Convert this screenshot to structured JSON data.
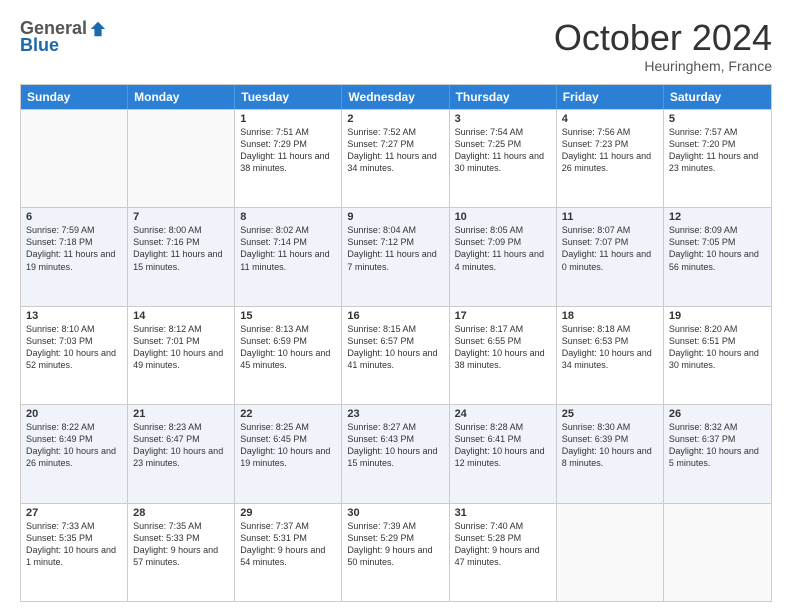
{
  "logo": {
    "general": "General",
    "blue": "Blue"
  },
  "header": {
    "month": "October 2024",
    "location": "Heuringhem, France"
  },
  "days_of_week": [
    "Sunday",
    "Monday",
    "Tuesday",
    "Wednesday",
    "Thursday",
    "Friday",
    "Saturday"
  ],
  "weeks": [
    [
      {
        "day": "",
        "sunrise": "",
        "sunset": "",
        "daylight": "",
        "empty": true
      },
      {
        "day": "",
        "sunrise": "",
        "sunset": "",
        "daylight": "",
        "empty": true
      },
      {
        "day": "1",
        "sunrise": "Sunrise: 7:51 AM",
        "sunset": "Sunset: 7:29 PM",
        "daylight": "Daylight: 11 hours and 38 minutes."
      },
      {
        "day": "2",
        "sunrise": "Sunrise: 7:52 AM",
        "sunset": "Sunset: 7:27 PM",
        "daylight": "Daylight: 11 hours and 34 minutes."
      },
      {
        "day": "3",
        "sunrise": "Sunrise: 7:54 AM",
        "sunset": "Sunset: 7:25 PM",
        "daylight": "Daylight: 11 hours and 30 minutes."
      },
      {
        "day": "4",
        "sunrise": "Sunrise: 7:56 AM",
        "sunset": "Sunset: 7:23 PM",
        "daylight": "Daylight: 11 hours and 26 minutes."
      },
      {
        "day": "5",
        "sunrise": "Sunrise: 7:57 AM",
        "sunset": "Sunset: 7:20 PM",
        "daylight": "Daylight: 11 hours and 23 minutes."
      }
    ],
    [
      {
        "day": "6",
        "sunrise": "Sunrise: 7:59 AM",
        "sunset": "Sunset: 7:18 PM",
        "daylight": "Daylight: 11 hours and 19 minutes."
      },
      {
        "day": "7",
        "sunrise": "Sunrise: 8:00 AM",
        "sunset": "Sunset: 7:16 PM",
        "daylight": "Daylight: 11 hours and 15 minutes."
      },
      {
        "day": "8",
        "sunrise": "Sunrise: 8:02 AM",
        "sunset": "Sunset: 7:14 PM",
        "daylight": "Daylight: 11 hours and 11 minutes."
      },
      {
        "day": "9",
        "sunrise": "Sunrise: 8:04 AM",
        "sunset": "Sunset: 7:12 PM",
        "daylight": "Daylight: 11 hours and 7 minutes."
      },
      {
        "day": "10",
        "sunrise": "Sunrise: 8:05 AM",
        "sunset": "Sunset: 7:09 PM",
        "daylight": "Daylight: 11 hours and 4 minutes."
      },
      {
        "day": "11",
        "sunrise": "Sunrise: 8:07 AM",
        "sunset": "Sunset: 7:07 PM",
        "daylight": "Daylight: 11 hours and 0 minutes."
      },
      {
        "day": "12",
        "sunrise": "Sunrise: 8:09 AM",
        "sunset": "Sunset: 7:05 PM",
        "daylight": "Daylight: 10 hours and 56 minutes."
      }
    ],
    [
      {
        "day": "13",
        "sunrise": "Sunrise: 8:10 AM",
        "sunset": "Sunset: 7:03 PM",
        "daylight": "Daylight: 10 hours and 52 minutes."
      },
      {
        "day": "14",
        "sunrise": "Sunrise: 8:12 AM",
        "sunset": "Sunset: 7:01 PM",
        "daylight": "Daylight: 10 hours and 49 minutes."
      },
      {
        "day": "15",
        "sunrise": "Sunrise: 8:13 AM",
        "sunset": "Sunset: 6:59 PM",
        "daylight": "Daylight: 10 hours and 45 minutes."
      },
      {
        "day": "16",
        "sunrise": "Sunrise: 8:15 AM",
        "sunset": "Sunset: 6:57 PM",
        "daylight": "Daylight: 10 hours and 41 minutes."
      },
      {
        "day": "17",
        "sunrise": "Sunrise: 8:17 AM",
        "sunset": "Sunset: 6:55 PM",
        "daylight": "Daylight: 10 hours and 38 minutes."
      },
      {
        "day": "18",
        "sunrise": "Sunrise: 8:18 AM",
        "sunset": "Sunset: 6:53 PM",
        "daylight": "Daylight: 10 hours and 34 minutes."
      },
      {
        "day": "19",
        "sunrise": "Sunrise: 8:20 AM",
        "sunset": "Sunset: 6:51 PM",
        "daylight": "Daylight: 10 hours and 30 minutes."
      }
    ],
    [
      {
        "day": "20",
        "sunrise": "Sunrise: 8:22 AM",
        "sunset": "Sunset: 6:49 PM",
        "daylight": "Daylight: 10 hours and 26 minutes."
      },
      {
        "day": "21",
        "sunrise": "Sunrise: 8:23 AM",
        "sunset": "Sunset: 6:47 PM",
        "daylight": "Daylight: 10 hours and 23 minutes."
      },
      {
        "day": "22",
        "sunrise": "Sunrise: 8:25 AM",
        "sunset": "Sunset: 6:45 PM",
        "daylight": "Daylight: 10 hours and 19 minutes."
      },
      {
        "day": "23",
        "sunrise": "Sunrise: 8:27 AM",
        "sunset": "Sunset: 6:43 PM",
        "daylight": "Daylight: 10 hours and 15 minutes."
      },
      {
        "day": "24",
        "sunrise": "Sunrise: 8:28 AM",
        "sunset": "Sunset: 6:41 PM",
        "daylight": "Daylight: 10 hours and 12 minutes."
      },
      {
        "day": "25",
        "sunrise": "Sunrise: 8:30 AM",
        "sunset": "Sunset: 6:39 PM",
        "daylight": "Daylight: 10 hours and 8 minutes."
      },
      {
        "day": "26",
        "sunrise": "Sunrise: 8:32 AM",
        "sunset": "Sunset: 6:37 PM",
        "daylight": "Daylight: 10 hours and 5 minutes."
      }
    ],
    [
      {
        "day": "27",
        "sunrise": "Sunrise: 7:33 AM",
        "sunset": "Sunset: 5:35 PM",
        "daylight": "Daylight: 10 hours and 1 minute."
      },
      {
        "day": "28",
        "sunrise": "Sunrise: 7:35 AM",
        "sunset": "Sunset: 5:33 PM",
        "daylight": "Daylight: 9 hours and 57 minutes."
      },
      {
        "day": "29",
        "sunrise": "Sunrise: 7:37 AM",
        "sunset": "Sunset: 5:31 PM",
        "daylight": "Daylight: 9 hours and 54 minutes."
      },
      {
        "day": "30",
        "sunrise": "Sunrise: 7:39 AM",
        "sunset": "Sunset: 5:29 PM",
        "daylight": "Daylight: 9 hours and 50 minutes."
      },
      {
        "day": "31",
        "sunrise": "Sunrise: 7:40 AM",
        "sunset": "Sunset: 5:28 PM",
        "daylight": "Daylight: 9 hours and 47 minutes."
      },
      {
        "day": "",
        "sunrise": "",
        "sunset": "",
        "daylight": "",
        "empty": true
      },
      {
        "day": "",
        "sunrise": "",
        "sunset": "",
        "daylight": "",
        "empty": true
      }
    ]
  ]
}
